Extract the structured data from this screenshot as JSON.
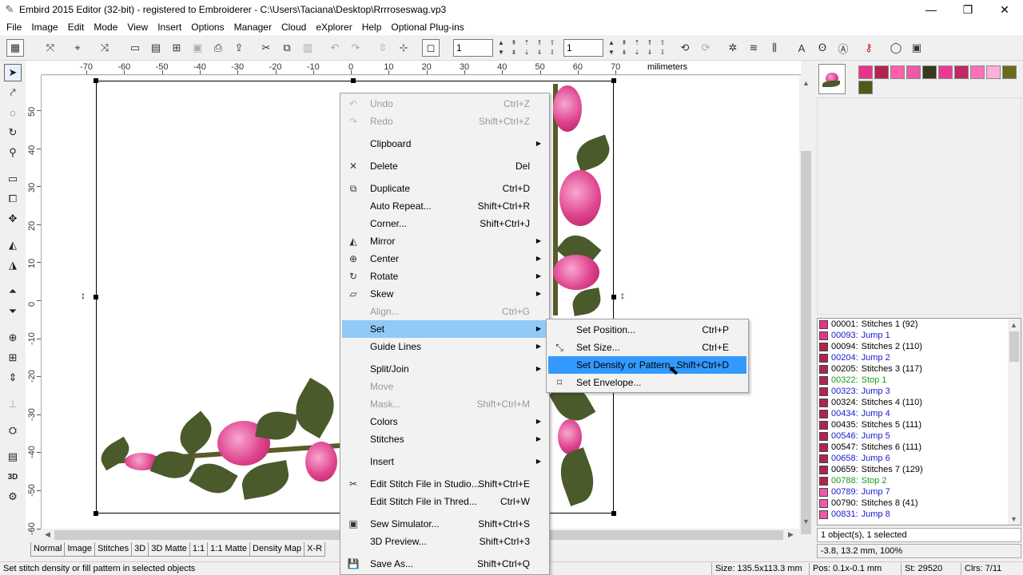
{
  "window": {
    "title": "Embird 2015 Editor (32-bit) - registered to Embroiderer - C:\\Users\\Taciana\\Desktop\\Rrrroseswag.vp3",
    "minimize": "—",
    "maximize": "❐",
    "close": "✕"
  },
  "menubar": [
    "File",
    "Image",
    "Edit",
    "Mode",
    "View",
    "Insert",
    "Options",
    "Manager",
    "Cloud",
    "eXplorer",
    "Help",
    "Optional Plug-ins"
  ],
  "toolbar": {
    "field1": "1",
    "field2": "1"
  },
  "ruler": {
    "units": "milimeters",
    "top_labels": [
      "-70",
      "-60",
      "-50",
      "-40",
      "-30",
      "-20",
      "-10",
      "0",
      "10",
      "20",
      "30",
      "40",
      "50",
      "60",
      "70"
    ],
    "left_labels": [
      "50",
      "40",
      "30",
      "20",
      "10",
      "0",
      "-10",
      "-20",
      "-30",
      "-40",
      "-50",
      "-60"
    ]
  },
  "tabs": [
    "Normal",
    "Image",
    "Stitches",
    "3D",
    "3D Matte",
    "1:1",
    "1:1 Matte",
    "Density Map",
    "X-R"
  ],
  "status": {
    "message": "Set stitch density or fill pattern in selected objects",
    "size": "Size: 135.5x113.3 mm",
    "pos": "Pos: 0.1x-0.1 mm",
    "stitches": "St: 29520",
    "colors": "Clrs: 7/11"
  },
  "palette_colors": [
    "#e8338c",
    "#b0244f",
    "#ff5fa8",
    "#f058a8",
    "#3a3a1a",
    "#ea3a90",
    "#c02a60",
    "#ff6fb8",
    "#ffb0d8",
    "#6a6a1a",
    "#4f5a1a"
  ],
  "stitch_list": [
    {
      "id": "00001:",
      "label": "Stitches 1 (92)",
      "color": "#e8338c",
      "kind": "stitch"
    },
    {
      "id": "00093:",
      "label": "Jump 1",
      "color": "#e8338c",
      "kind": "jump"
    },
    {
      "id": "00094:",
      "label": "Stitches 2 (110)",
      "color": "#b0244f",
      "kind": "stitch"
    },
    {
      "id": "00204:",
      "label": "Jump 2",
      "color": "#b0244f",
      "kind": "jump"
    },
    {
      "id": "00205:",
      "label": "Stitches 3 (117)",
      "color": "#b0244f",
      "kind": "stitch"
    },
    {
      "id": "00322:",
      "label": "Stop 1",
      "color": "#b0244f",
      "kind": "stop"
    },
    {
      "id": "00323:",
      "label": "Jump 3",
      "color": "#b0244f",
      "kind": "jump"
    },
    {
      "id": "00324:",
      "label": "Stitches 4 (110)",
      "color": "#b0244f",
      "kind": "stitch"
    },
    {
      "id": "00434:",
      "label": "Jump 4",
      "color": "#b0244f",
      "kind": "jump"
    },
    {
      "id": "00435:",
      "label": "Stitches 5 (111)",
      "color": "#b0244f",
      "kind": "stitch"
    },
    {
      "id": "00546:",
      "label": "Jump 5",
      "color": "#b0244f",
      "kind": "jump"
    },
    {
      "id": "00547:",
      "label": "Stitches 6 (111)",
      "color": "#b0244f",
      "kind": "stitch"
    },
    {
      "id": "00658:",
      "label": "Jump 6",
      "color": "#b0244f",
      "kind": "jump"
    },
    {
      "id": "00659:",
      "label": "Stitches 7 (129)",
      "color": "#b0244f",
      "kind": "stitch"
    },
    {
      "id": "00788:",
      "label": "Stop 2",
      "color": "#b0244f",
      "kind": "stop"
    },
    {
      "id": "00789:",
      "label": "Jump 7",
      "color": "#f058a8",
      "kind": "jump"
    },
    {
      "id": "00790:",
      "label": "Stitches 8 (41)",
      "color": "#f058a8",
      "kind": "stitch"
    },
    {
      "id": "00831:",
      "label": "Jump 8",
      "color": "#f058a8",
      "kind": "jump"
    }
  ],
  "selection_info": "1 object(s), 1 selected",
  "position_info": "-3.8, 13.2 mm, 100%",
  "context_menu": [
    {
      "label": "Undo",
      "shortcut": "Ctrl+Z",
      "icon": "↶",
      "disabled": true
    },
    {
      "label": "Redo",
      "shortcut": "Shift+Ctrl+Z",
      "icon": "↷",
      "disabled": true
    },
    {
      "label": "Clipboard",
      "submenu": true
    },
    {
      "label": "Delete",
      "shortcut": "Del",
      "icon": "✕"
    },
    {
      "label": "Duplicate",
      "shortcut": "Ctrl+D",
      "icon": "⧉"
    },
    {
      "label": "Auto Repeat...",
      "shortcut": "Shift+Ctrl+R"
    },
    {
      "label": "Corner...",
      "shortcut": "Shift+Ctrl+J"
    },
    {
      "label": "Mirror",
      "submenu": true,
      "icon": "◭"
    },
    {
      "label": "Center",
      "submenu": true,
      "icon": "⊕"
    },
    {
      "label": "Rotate",
      "submenu": true,
      "icon": "↻"
    },
    {
      "label": "Skew",
      "submenu": true,
      "icon": "▱"
    },
    {
      "label": "Align...",
      "shortcut": "Ctrl+G",
      "disabled": true
    },
    {
      "label": "Set",
      "submenu": true,
      "highlight": true
    },
    {
      "label": "Guide Lines",
      "submenu": true
    },
    {
      "label": "Split/Join",
      "submenu": true
    },
    {
      "label": "Move",
      "disabled": true
    },
    {
      "label": "Mask...",
      "shortcut": "Shift+Ctrl+M",
      "disabled": true
    },
    {
      "label": "Colors",
      "submenu": true
    },
    {
      "label": "Stitches",
      "submenu": true
    },
    {
      "label": "Insert",
      "submenu": true
    },
    {
      "label": "Edit Stitch File in Studio...",
      "shortcut": "Shift+Ctrl+E",
      "icon": "✂"
    },
    {
      "label": "Edit Stitch File in Thred...",
      "shortcut": "Ctrl+W"
    },
    {
      "label": "Sew Simulator...",
      "shortcut": "Shift+Ctrl+S",
      "icon": "▣"
    },
    {
      "label": "3D Preview...",
      "shortcut": "Shift+Ctrl+3"
    },
    {
      "label": "Save As...",
      "shortcut": "Shift+Ctrl+Q",
      "icon": "💾"
    }
  ],
  "set_submenu": [
    {
      "label": "Set Position...",
      "shortcut": "Ctrl+P"
    },
    {
      "label": "Set Size...",
      "shortcut": "Ctrl+E",
      "icon": "⤡"
    },
    {
      "label": "Set Density or Pattern...",
      "shortcut": "Shift+Ctrl+D",
      "highlight": true
    },
    {
      "label": "Set Envelope...",
      "icon": "⌑"
    }
  ],
  "colors": {
    "menu_highlight": "#91c9f7",
    "submenu_highlight": "#3399ff",
    "jump_text": "#1a1ad0",
    "stop_text": "#1a9a1a"
  }
}
